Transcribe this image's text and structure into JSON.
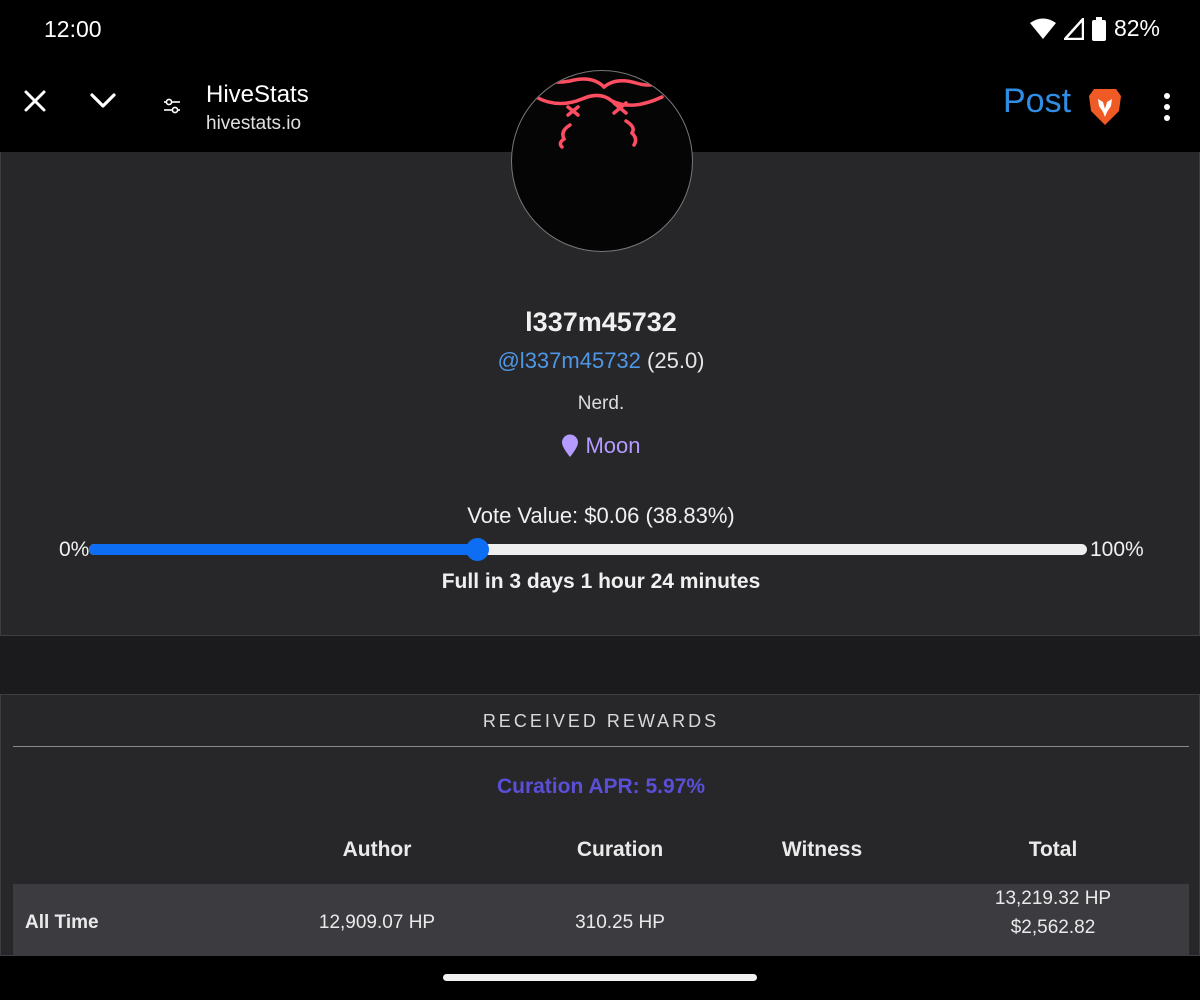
{
  "status_bar": {
    "time": "12:00",
    "battery": "82%"
  },
  "toolbar": {
    "site_title": "HiveStats",
    "site_url": "hivestats.io",
    "post_label": "Post"
  },
  "profile": {
    "display_name": "l337m45732",
    "handle": "@l337m45732",
    "reputation": "(25.0)",
    "bio": "Nerd.",
    "location": "Moon",
    "vote_value_text": "Vote Value: $0.06 (38.83%)",
    "vote_min_label": "0%",
    "vote_max_label": "100%",
    "vote_power_fraction": 0.3883,
    "full_in_text": "Full in 3 days 1 hour 24 minutes"
  },
  "rewards": {
    "heading": "RECEIVED REWARDS",
    "curation_apr": "Curation APR: 5.97%",
    "columns": [
      "Author",
      "Curation",
      "Witness",
      "Total"
    ],
    "rows": [
      {
        "label": "All Time",
        "author": "12,909.07 HP",
        "curation": "310.25 HP",
        "witness": "",
        "total_hp": "13,219.32 HP",
        "total_usd": "$2,562.82"
      }
    ]
  },
  "colors": {
    "accent_link": "#4f97e6",
    "post_blue": "#2f8de4",
    "location_purple": "#b59bff",
    "apr_indigo": "#5a4fd6",
    "slider_blue": "#0d6ef3",
    "card_bg": "#27272a",
    "page_bg": "#1b1b1d"
  },
  "icons": {
    "close": "close-icon",
    "chevron": "chevron-down-icon",
    "tune": "tune-icon",
    "brave": "brave-lion-icon",
    "menu": "more-vert-icon",
    "location": "map-pin-icon",
    "wifi": "wifi-icon",
    "signal": "signal-icon",
    "battery": "battery-icon"
  }
}
